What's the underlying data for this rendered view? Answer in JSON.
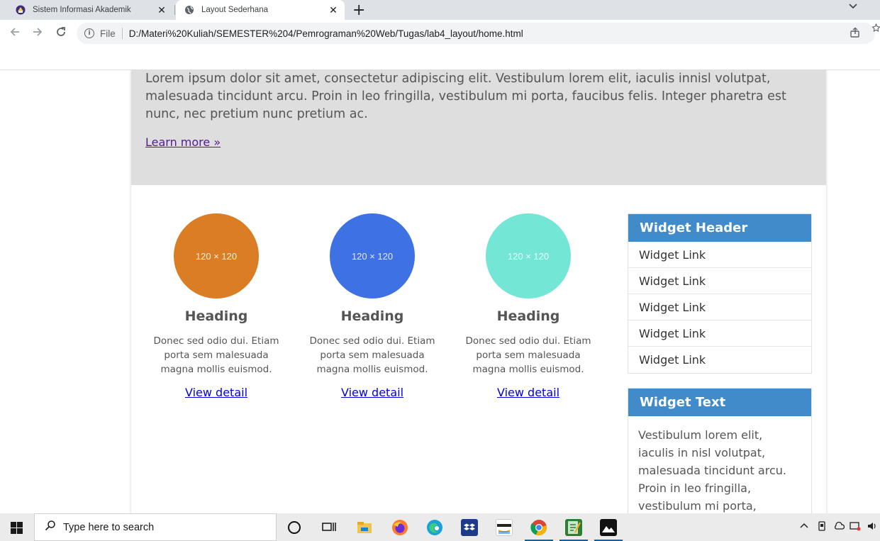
{
  "browser": {
    "tabs": [
      {
        "title": "Sistem Informasi Akademik",
        "close": "✕"
      },
      {
        "title": "Layout Sederhana",
        "close": "✕"
      }
    ],
    "new_tab": "+",
    "tab_menu": "⌄",
    "scheme_label": "File",
    "url": "D:/Materi%20Kuliah/SEMESTER%204/Pemrograman%20Web/Tugas/lab4_layout/home.html"
  },
  "page": {
    "intro_text": "Lorem ipsum dolor sit amet, consectetur adipiscing elit. Vestibulum lorem elit, iaculis innisl volutpat, malesuada tincidunt arcu. Proin in leo fringilla, vestibulum mi porta, faucibus felis. Integer pharetra est nunc, nec pretium nunc pretium ac.",
    "learn_more": "Learn more »",
    "features": [
      {
        "placeholder": "120 × 120",
        "color": "#db7d24",
        "heading": "Heading",
        "text": "Donec sed odio dui. Etiam porta sem malesuada magna mollis euismod.",
        "link": "View detail"
      },
      {
        "placeholder": "120 × 120",
        "color": "#3e71e3",
        "heading": "Heading",
        "text": "Donec sed odio dui. Etiam porta sem malesuada magna mollis euismod.",
        "link": "View detail"
      },
      {
        "placeholder": "120 × 120",
        "color": "#74e6d6",
        "heading": "Heading",
        "text": "Donec sed odio dui. Etiam porta sem malesuada magna mollis euismod.",
        "link": "View detail"
      }
    ],
    "widget_links": {
      "header": "Widget Header",
      "links": [
        "Widget Link",
        "Widget Link",
        "Widget Link",
        "Widget Link",
        "Widget Link"
      ]
    },
    "widget_text": {
      "header": "Widget Text",
      "body": "Vestibulum lorem elit, iaculis in nisl volutpat, malesuada tincidunt arcu. Proin in leo fringilla, vestibulum mi porta, faucibus felis. Integer"
    }
  },
  "taskbar": {
    "search_placeholder": "Type here to search"
  },
  "colors": {
    "accent": "#428bca",
    "jumbotron_bg": "#dedede"
  }
}
